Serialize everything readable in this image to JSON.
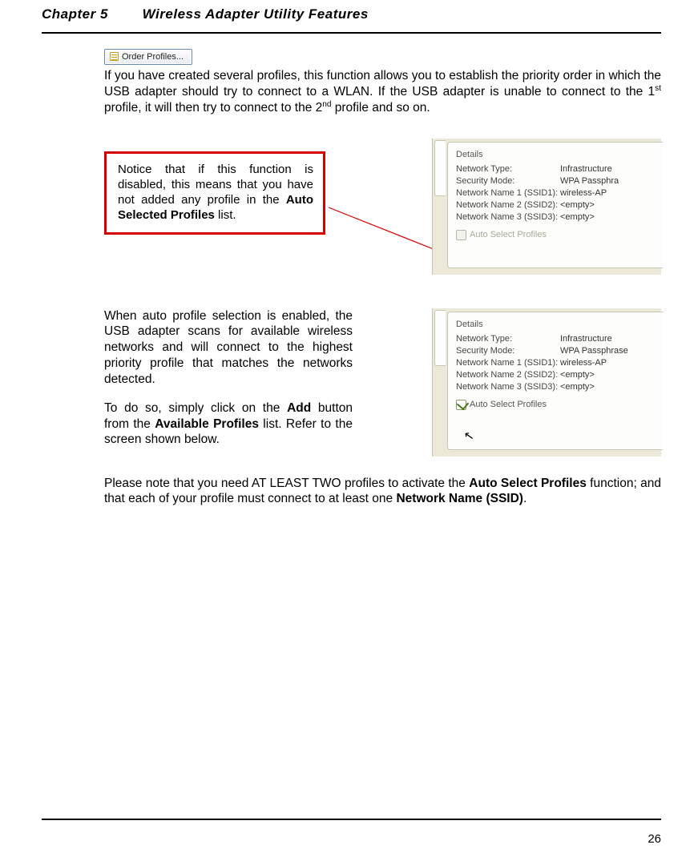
{
  "header": {
    "chapter": "Chapter 5",
    "title": "Wireless Adapter Utility Features"
  },
  "order_button": {
    "label": "Order Profiles..."
  },
  "para1": {
    "t1": "If you have created several profiles, this function allows you to establish the priority order in which the USB adapter should try to connect to a WLAN. If the USB adapter is unable to connect to the 1",
    "sup1": "st",
    "t2": " profile, it will then try to connect to the 2",
    "sup2": "nd",
    "t3": " profile and so on."
  },
  "callout": {
    "t1": "Notice that if this function is disabled, this means that you have not added any profile in the ",
    "b1": "Auto Selected Profiles",
    "t2": " list."
  },
  "details": {
    "title": "Details",
    "rows": [
      {
        "k": "Network Type:",
        "v": "Infrastructure"
      },
      {
        "k": "Security Mode:",
        "v": "WPA Passphra"
      },
      {
        "k": "Network Name 1 (SSID1):",
        "v": "wireless-AP"
      },
      {
        "k": "Network Name 2 (SSID2):",
        "v": "<empty>"
      },
      {
        "k": "Network Name 3 (SSID3):",
        "v": "<empty>"
      }
    ],
    "checkbox_label": "Auto Select Profiles"
  },
  "details2_security_v": "WPA Passphrase",
  "para2a": "When auto profile selection is enabled, the USB adapter scans for available wireless networks and will connect to the highest priority profile that matches the networks detected.",
  "para2b": {
    "t1": "To do so, simply click on the ",
    "b1": "Add",
    "t2": " button from the ",
    "b2": "Available Profiles",
    "t3": " list. Refer to the screen shown below."
  },
  "para3": {
    "t1": "Please note that you need AT LEAST TWO profiles to activate the ",
    "b1": "Auto Select Profiles",
    "t2": " function; and that each of your profile must connect to at least one ",
    "b2": "Network Name (SSID)",
    "t3": "."
  },
  "page_number": "26"
}
